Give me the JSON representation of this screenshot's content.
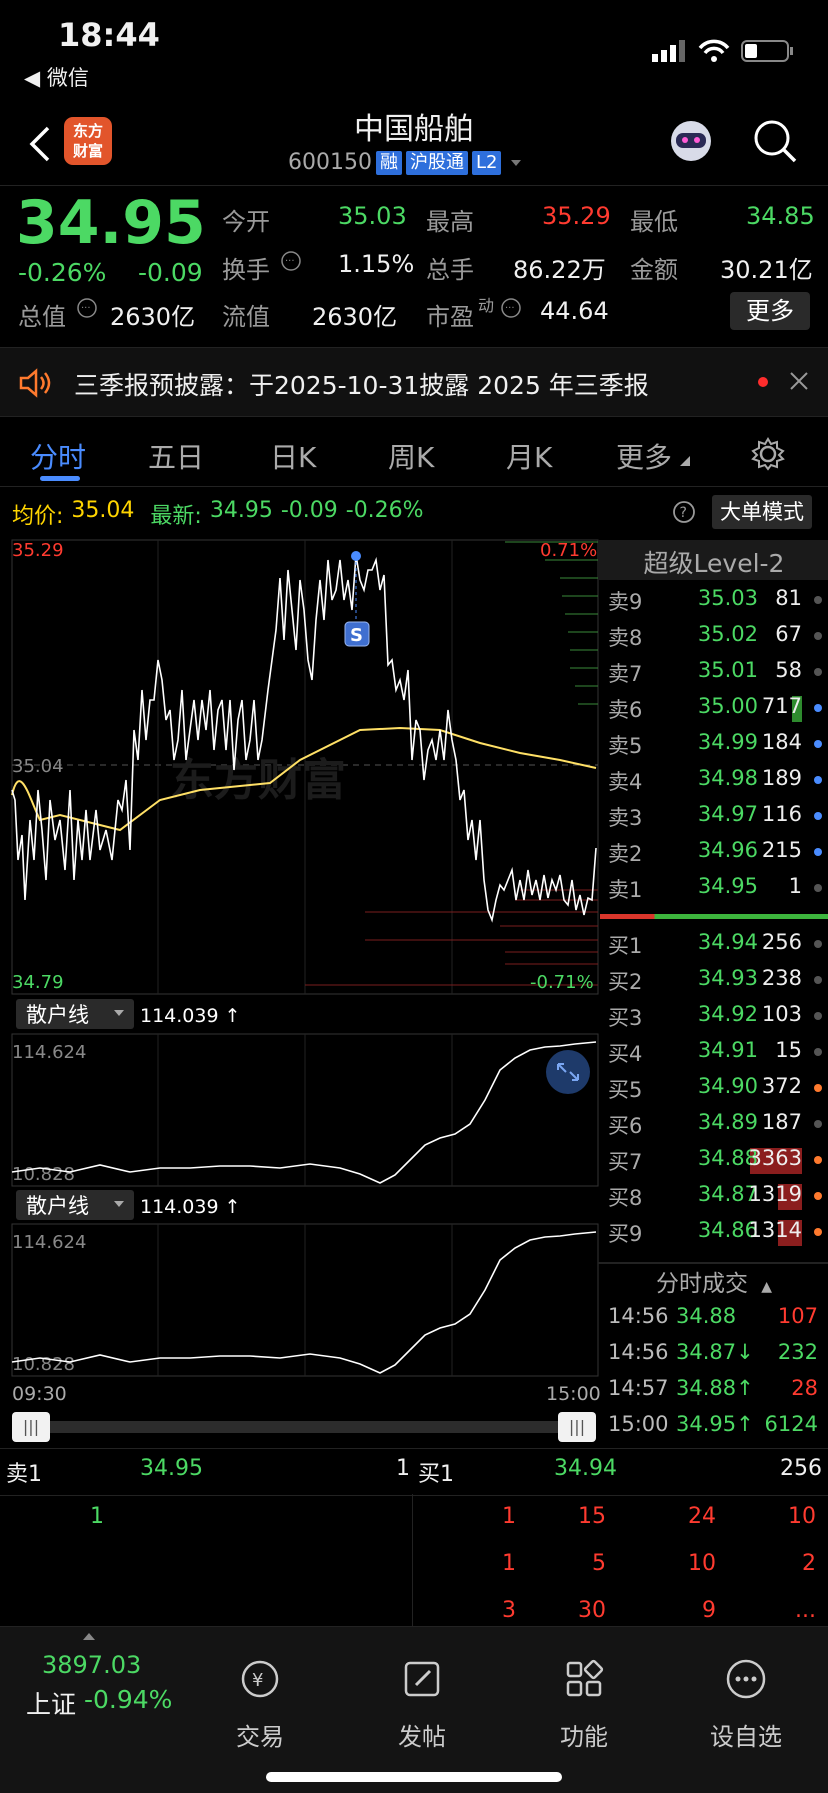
{
  "status_bar": {
    "time": "18:44",
    "back_app": "◀ 微信"
  },
  "nav": {
    "logo_line1": "东方",
    "logo_line2": "财富",
    "stock_name": "中国船舶",
    "stock_code": "600150",
    "tags": [
      "融",
      "沪股通",
      "L2"
    ]
  },
  "quote": {
    "price": "34.95",
    "change_pct": "-0.26%",
    "change": "-0.09",
    "open_label": "今开",
    "open": "35.03",
    "high_label": "最高",
    "high": "35.29",
    "low_label": "最低",
    "low": "34.85",
    "turnover_label": "换手",
    "turnover": "1.15%",
    "volume_label": "总手",
    "volume": "86.22万",
    "amount_label": "金额",
    "amount": "30.21亿",
    "mktcap_label": "总值",
    "mktcap": "2630亿",
    "float_label": "流值",
    "float": "2630亿",
    "pe_label": "市盈",
    "pe_super": "动",
    "pe": "44.64",
    "more": "更多"
  },
  "notice": {
    "text": "三季报预披露：于2025-10-31披露 2025 年三季报"
  },
  "tabs": [
    "分时",
    "五日",
    "日K",
    "周K",
    "月K",
    "更多"
  ],
  "chart_header": {
    "avg_label": "均价:",
    "avg": "35.04",
    "latest_label": "最新:",
    "latest": "34.95",
    "change": "-0.09",
    "change_pct": "-0.26%",
    "mode_button": "大单模式"
  },
  "chart_axis": {
    "y_top": "35.29",
    "y_mid": "35.04",
    "y_bottom": "34.79",
    "pct_top": "0.71%",
    "pct_bottom": "-0.71%",
    "x_start": "09:30",
    "x_end": "15:00",
    "marker": "S",
    "watermark": "东方财富"
  },
  "indicators": [
    {
      "name": "散户线",
      "value": "114.039 ↑",
      "y_top": "114.624",
      "y_bottom": "10.828"
    },
    {
      "name": "散户线",
      "value": "114.039 ↑",
      "y_top": "114.624",
      "y_bottom": "10.828"
    }
  ],
  "order_book": {
    "title": "超级Level-2",
    "asks": [
      {
        "label": "卖9",
        "price": "35.03",
        "vol": "81"
      },
      {
        "label": "卖8",
        "price": "35.02",
        "vol": "67"
      },
      {
        "label": "卖7",
        "price": "35.01",
        "vol": "58"
      },
      {
        "label": "卖6",
        "price": "35.00",
        "vol": "717"
      },
      {
        "label": "卖5",
        "price": "34.99",
        "vol": "184"
      },
      {
        "label": "卖4",
        "price": "34.98",
        "vol": "189"
      },
      {
        "label": "卖3",
        "price": "34.97",
        "vol": "116"
      },
      {
        "label": "卖2",
        "price": "34.96",
        "vol": "215"
      },
      {
        "label": "卖1",
        "price": "34.95",
        "vol": "1"
      }
    ],
    "bids": [
      {
        "label": "买1",
        "price": "34.94",
        "vol": "256"
      },
      {
        "label": "买2",
        "price": "34.93",
        "vol": "238"
      },
      {
        "label": "买3",
        "price": "34.92",
        "vol": "103"
      },
      {
        "label": "买4",
        "price": "34.91",
        "vol": "15"
      },
      {
        "label": "买5",
        "price": "34.90",
        "vol": "372"
      },
      {
        "label": "买6",
        "price": "34.89",
        "vol": "187"
      },
      {
        "label": "买7",
        "price": "34.88",
        "vol": "3363"
      },
      {
        "label": "买8",
        "price": "34.87",
        "vol": "1319"
      },
      {
        "label": "买9",
        "price": "34.86",
        "vol": "1314"
      }
    ],
    "trades_title": "分时成交",
    "trades": [
      {
        "time": "14:56",
        "price": "34.88",
        "vol": "107"
      },
      {
        "time": "14:56",
        "price": "34.87↓",
        "vol": "232"
      },
      {
        "time": "14:57",
        "price": "34.88↑",
        "vol": "28"
      },
      {
        "time": "15:00",
        "price": "34.95↑",
        "vol": "6124"
      }
    ]
  },
  "detail": {
    "sell_label": "卖1",
    "sell_price": "34.95",
    "sell_vol": "1",
    "buy_label": "买1",
    "buy_price": "34.94",
    "buy_vol": "256",
    "sell_queue": [
      "1"
    ],
    "buy_queue_rows": [
      [
        "1",
        "15",
        "24",
        "10"
      ],
      [
        "1",
        "5",
        "10",
        "2"
      ],
      [
        "3",
        "30",
        "9",
        "..."
      ]
    ]
  },
  "tabbar": {
    "index_value": "3897.03",
    "index_name": "上证",
    "index_change": "-0.94%",
    "items": [
      "交易",
      "发帖",
      "功能",
      "设自选"
    ]
  }
}
